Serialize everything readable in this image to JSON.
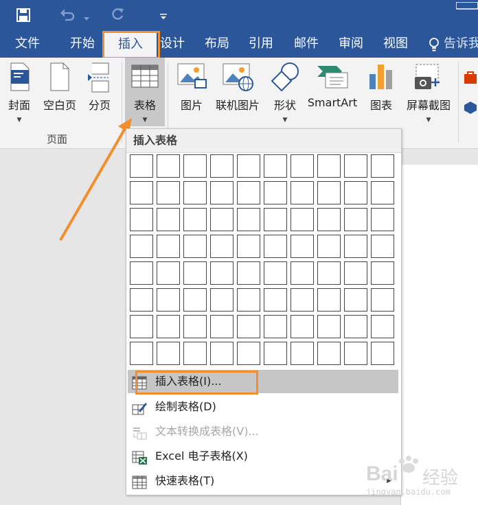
{
  "ribbon_tabs": {
    "file": "文件",
    "home": "开始",
    "insert": "插入",
    "design": "设计",
    "layout": "布局",
    "references": "引用",
    "mailings": "邮件",
    "review": "审阅",
    "view": "视图",
    "tell_me": "告诉我"
  },
  "pages_group": {
    "cover": "封面",
    "blank_page": "空白页",
    "page_break": "分页",
    "group_label": "页面"
  },
  "table_button": "表格",
  "illustrations": {
    "pictures": "图片",
    "online_pictures": "联机图片",
    "shapes": "形状",
    "smartart": "SmartArt",
    "chart": "图表",
    "screenshot": "屏幕截图"
  },
  "menu": {
    "title": "插入表格",
    "grid_rows": 8,
    "grid_cols": 10,
    "items": [
      {
        "label": "插入表格(I)...",
        "state": "highlighted",
        "icon": "insert-table-icon"
      },
      {
        "label": "绘制表格(D)",
        "state": "normal",
        "icon": "draw-table-icon"
      },
      {
        "label": "文本转换成表格(V)...",
        "state": "disabled",
        "icon": "text-to-table-icon"
      },
      {
        "label": "Excel 电子表格(X)",
        "state": "normal",
        "icon": "excel-table-icon"
      },
      {
        "label": "快速表格(T)",
        "state": "normal",
        "icon": "quick-table-icon"
      }
    ]
  },
  "watermark": {
    "brand": "Bai",
    "brand_cn": "经验",
    "url": "jingyan.baidu.com"
  },
  "colors": {
    "titlebar": "#2b579a",
    "ribbon": "#f3f3f3",
    "highlight_annotation": "#f28e2b",
    "menu_highlight": "#c6c6c6"
  }
}
